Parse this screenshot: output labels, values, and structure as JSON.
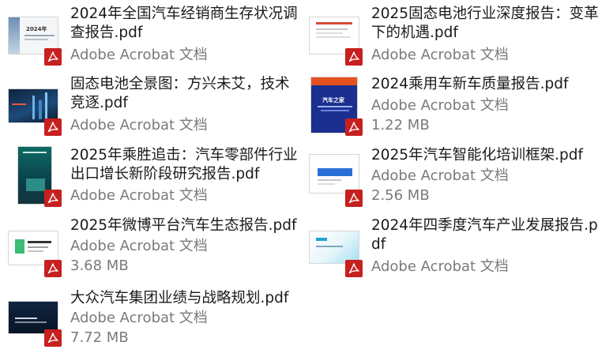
{
  "files": [
    {
      "name": "2024年全国汽车经销商生存状况调查报告.pdf",
      "app": "Adobe Acrobat 文档",
      "size": "",
      "thumb": {
        "style": "report-white",
        "label": "2024年"
      }
    },
    {
      "name": "2025固态电池行业深度报告：变革下的机遇.pdf",
      "app": "Adobe Acrobat 文档",
      "size": "",
      "thumb": {
        "style": "doc-white-red",
        "label": ""
      }
    },
    {
      "name": "固态电池全景图：方兴未艾，技术竞逐.pdf",
      "app": "Adobe Acrobat 文档",
      "size": "",
      "thumb": {
        "style": "dark-city",
        "label": ""
      }
    },
    {
      "name": "2024乘用车新车质量报告.pdf",
      "app": "Adobe Acrobat 文档",
      "size": "1.22 MB",
      "thumb": {
        "style": "blue-cover",
        "label": "汽车之家"
      }
    },
    {
      "name": "2025年乘胜追击：汽车零部件行业出口增长新阶段研究报告.pdf",
      "app": "Adobe Acrobat 文档",
      "size": "",
      "thumb": {
        "style": "teal-cover",
        "label": ""
      }
    },
    {
      "name": "2025年汽车智能化培训框架.pdf",
      "app": "Adobe Acrobat 文档",
      "size": "2.56 MB",
      "thumb": {
        "style": "white-blue-box",
        "label": ""
      }
    },
    {
      "name": "2025年微博平台汽车生态报告.pdf",
      "app": "Adobe Acrobat 文档",
      "size": "3.68 MB",
      "thumb": {
        "style": "white-green",
        "label": ""
      }
    },
    {
      "name": "2024年四季度汽车产业发展报告.pdf",
      "app": "Adobe Acrobat 文档",
      "size": "",
      "thumb": {
        "style": "cyan-gradient",
        "label": ""
      }
    },
    {
      "name": "大众汽车集团业绩与战略规划.pdf",
      "app": "Adobe Acrobat 文档",
      "size": "7.72 MB",
      "thumb": {
        "style": "dark-navy",
        "label": ""
      }
    }
  ],
  "colors": {
    "pdf_badge": "#c6201f",
    "meta_text": "#7a7a7a",
    "name_text": "#1a1a1a"
  },
  "icons": {
    "badge": "adobe-pdf-icon"
  }
}
